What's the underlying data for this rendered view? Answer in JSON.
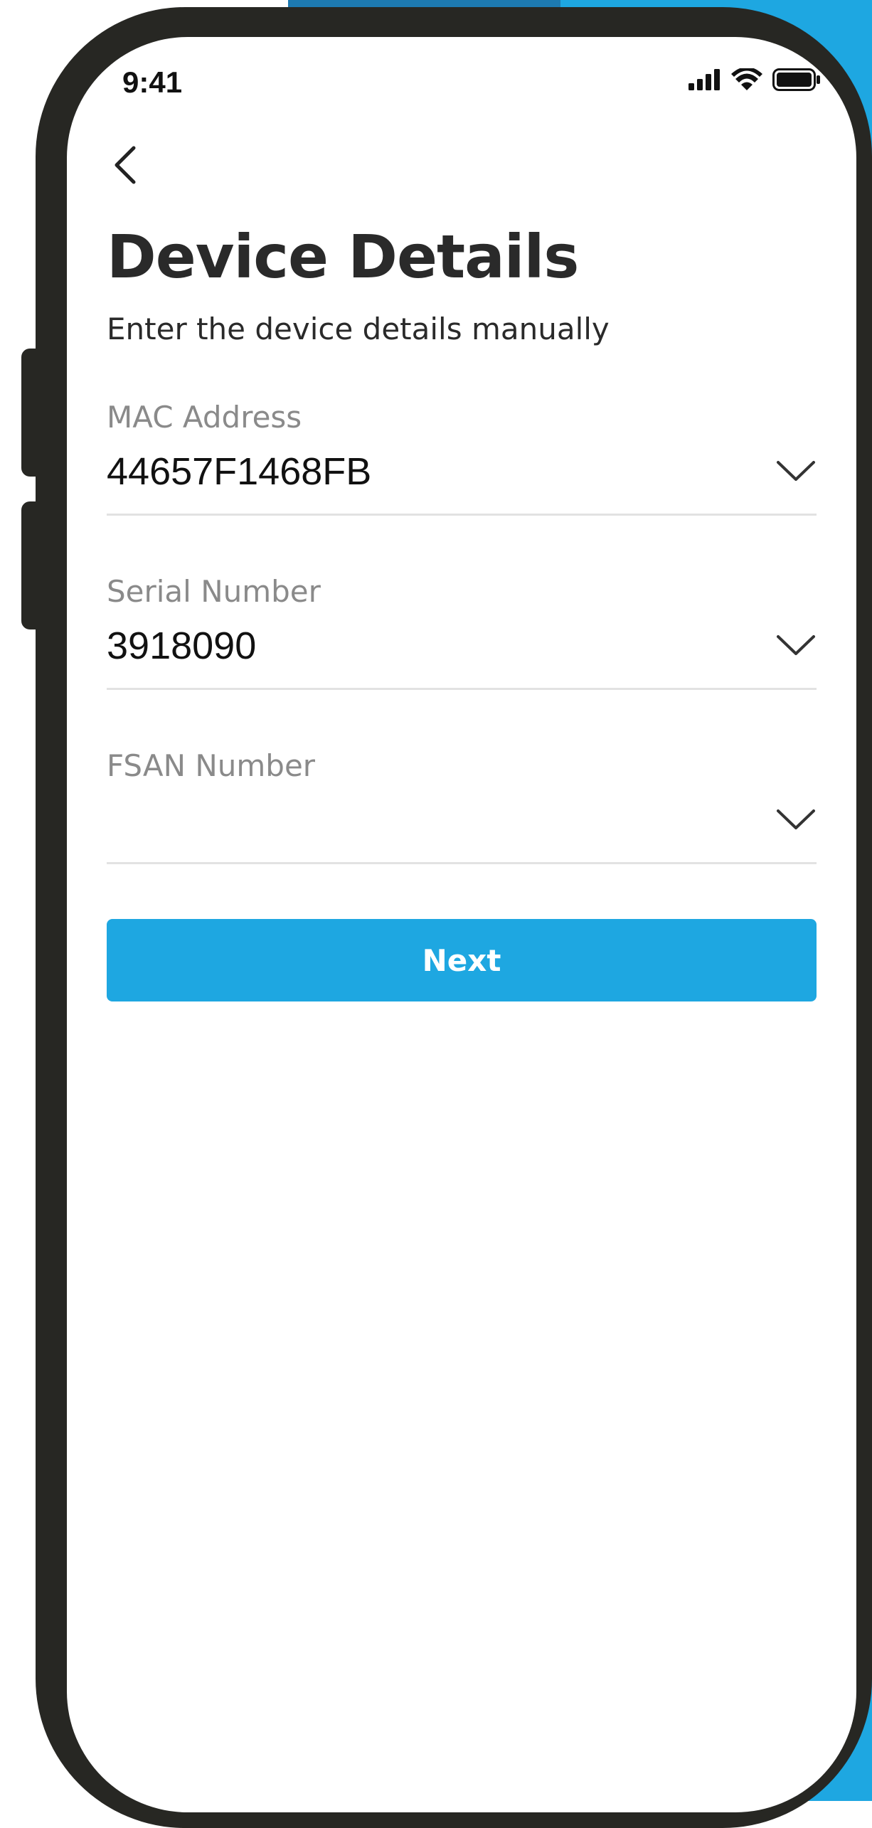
{
  "status_bar": {
    "time": "9:41"
  },
  "header": {
    "title": "Device Details",
    "subtitle": "Enter the device details manually"
  },
  "form": {
    "fields": [
      {
        "label": "MAC Address",
        "value": "44657F1468FB"
      },
      {
        "label": "Serial Number",
        "value": "3918090"
      },
      {
        "label": "FSAN Number",
        "value": ""
      }
    ]
  },
  "actions": {
    "next_label": "Next"
  },
  "icons": {
    "back": "chevron-left-icon",
    "dropdown": "chevron-down-icon",
    "signal": "signal-icon",
    "wifi": "wifi-icon",
    "battery": "battery-icon"
  },
  "colors": {
    "accent": "#1ea7e1",
    "frame": "#272723",
    "background_alt": "#1d7ab1"
  }
}
